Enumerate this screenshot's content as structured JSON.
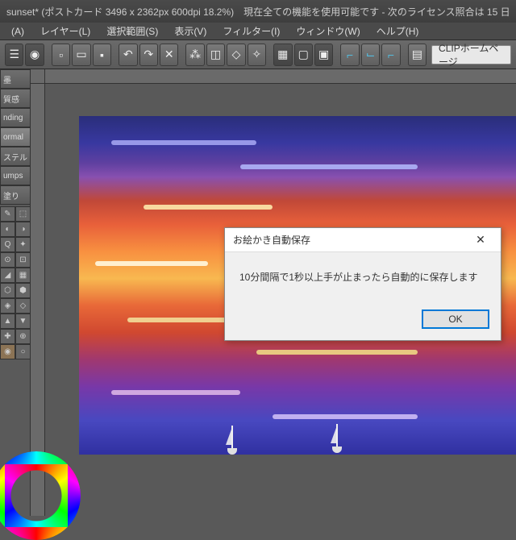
{
  "title": "sunset* (ポストカード 3496 x 2362px 600dpi 18.2%)　現在全ての機能を使用可能です - 次のライセンス照合は 15 日",
  "menu": {
    "a": "(A)",
    "layer": "レイヤー(L)",
    "select": "選択範囲(S)",
    "view": "表示(V)",
    "filter": "フィルター(I)",
    "window": "ウィンドウ(W)",
    "help": "ヘルプ(H)"
  },
  "clip_home": "CLIPホームページ",
  "brush_tabs": [
    "墨",
    "質感",
    "nding",
    "ormal",
    "ステル",
    "umps",
    "塗り"
  ],
  "dialog": {
    "title": "お絵かき自動保存",
    "message": "10分間隔で1秒以上手が止まったら自動的に保存します",
    "ok": "OK"
  }
}
